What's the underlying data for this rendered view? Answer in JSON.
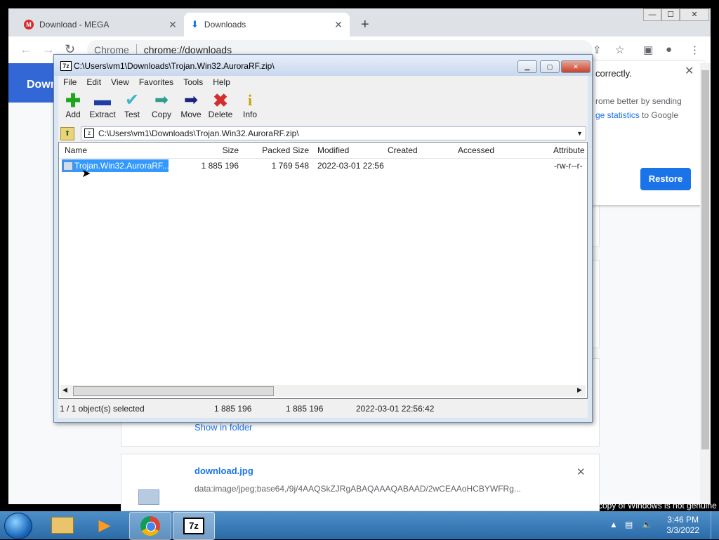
{
  "browser": {
    "tabs": [
      {
        "label": "Download - MEGA",
        "icon": "mega-logo-icon",
        "close": "✕"
      },
      {
        "label": "Downloads",
        "icon": "download-icon",
        "close": "✕"
      }
    ],
    "new_tab": "+",
    "window_controls": [
      "—",
      "☐",
      "✕"
    ],
    "omnibox": {
      "site_label": "Chrome",
      "url": "chrome://downloads"
    },
    "page_header": "Downlo",
    "notice": {
      "line1": "correctly.",
      "line2": "rome better by sending",
      "line3_link": "ge statistics",
      "line3_rest": " to Google",
      "button": "Restore",
      "close": "✕"
    },
    "download_item": {
      "show_in_folder": "Show in folder",
      "filename": "download.jpg",
      "url": "data:image/jpeg;base64,/9j/4AAQSkZJRgABAQAAAQABAAD/2wCEAAoHCBYWFRg..."
    }
  },
  "sevenzip": {
    "title": "C:\\Users\\vm1\\Downloads\\Trojan.Win32.AuroraRF.zip\\",
    "app_icon": "7z",
    "menu": [
      "File",
      "Edit",
      "View",
      "Favorites",
      "Tools",
      "Help"
    ],
    "toolbar": [
      {
        "label": "Add",
        "icon": "plus-icon",
        "color": "#1fa51f"
      },
      {
        "label": "Extract",
        "icon": "minus-icon",
        "color": "#1f3fa5"
      },
      {
        "label": "Test",
        "icon": "check-icon",
        "color": "#3bb5c7"
      },
      {
        "label": "Copy",
        "icon": "copy-arrow-icon",
        "color": "#2e9e8e"
      },
      {
        "label": "Move",
        "icon": "move-arrow-icon",
        "color": "#1a237e"
      },
      {
        "label": "Delete",
        "icon": "delete-x-icon",
        "color": "#d32f2f"
      },
      {
        "label": "Info",
        "icon": "info-icon",
        "color": "#c9a400"
      }
    ],
    "path": "C:\\Users\\vm1\\Downloads\\Trojan.Win32.AuroraRF.zip\\",
    "columns": [
      "Name",
      "Size",
      "Packed Size",
      "Modified",
      "Created",
      "Accessed",
      "Attribute"
    ],
    "rows": [
      {
        "name": "Trojan.Win32.AuroraRF....",
        "size": "1 885 196",
        "packed": "1 769 548",
        "modified": "2022-03-01 22:56",
        "created": "",
        "accessed": "",
        "attributes": "-rw-r--r-"
      }
    ],
    "status": {
      "selection": "1 / 1 object(s) selected",
      "size": "1 885 196",
      "packed": "1 885 196",
      "modified": "2022-03-01 22:56:42"
    }
  },
  "taskbar": {
    "apps": [
      "windows-explorer",
      "media-player",
      "chrome",
      "7-zip"
    ],
    "app_7z_label": "7z",
    "clock_time": "3:46 PM",
    "clock_date": "3/3/2022"
  },
  "watermark": "This copy of Windows is not genuine"
}
